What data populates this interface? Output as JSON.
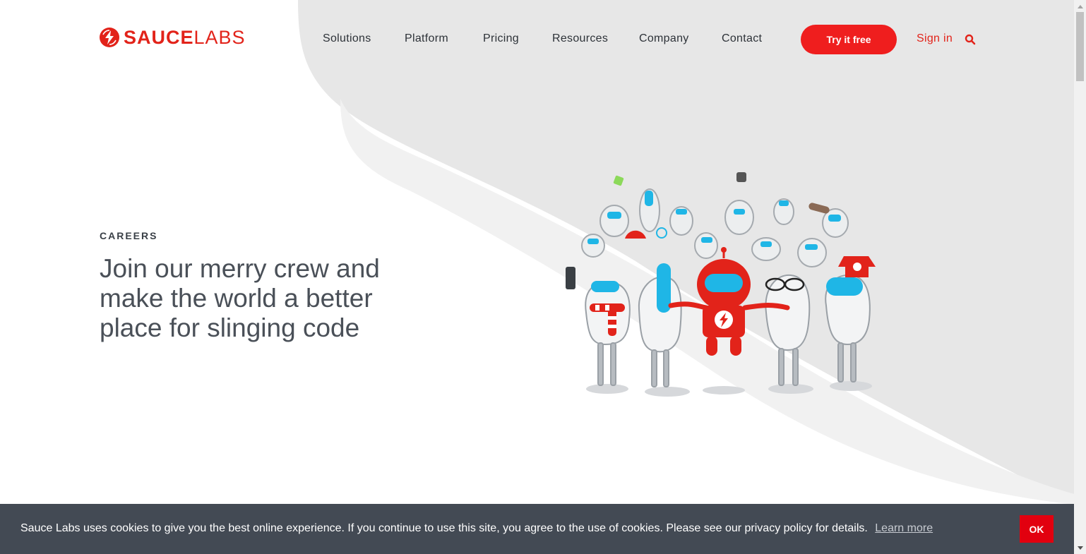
{
  "brand": {
    "name_part1": "SAUCE",
    "name_part2": "LABS",
    "color": "#e2231a"
  },
  "nav": {
    "items": [
      {
        "label": "Solutions"
      },
      {
        "label": "Platform"
      },
      {
        "label": "Pricing"
      },
      {
        "label": "Resources"
      },
      {
        "label": "Company"
      },
      {
        "label": "Contact"
      }
    ],
    "cta_label": "Try it free",
    "signin_label": "Sign in",
    "search_icon": "search-icon"
  },
  "hero": {
    "eyebrow": "CAREERS",
    "headline": "Join our merry crew and make the world a better place for slinging code",
    "illustration": "robot-crew-illustration"
  },
  "cookie_banner": {
    "text": "Sauce Labs uses cookies to give you the best online experience. If you continue to use this site, you agree to the use of cookies. Please see our privacy policy for details.",
    "link_label": "Learn more",
    "ok_label": "OK"
  },
  "colors": {
    "accent": "#ef1e1e",
    "text_dark": "#2d3238",
    "banner_bg": "#434a54",
    "robot_blue": "#1fb6e6"
  }
}
